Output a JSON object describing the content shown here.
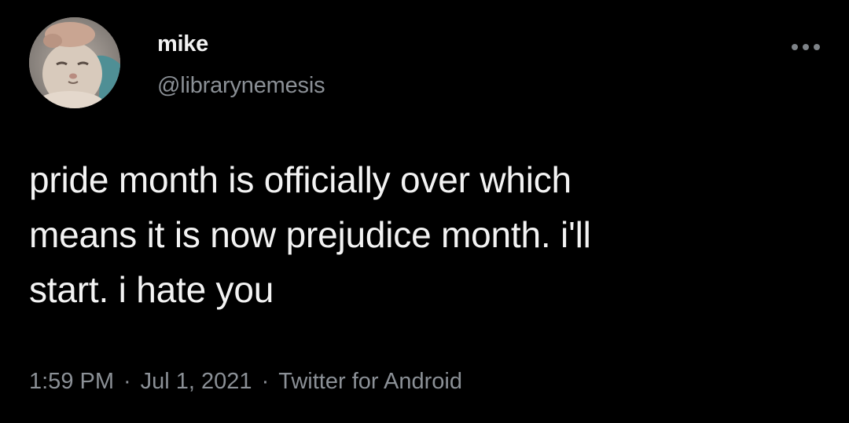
{
  "tweet": {
    "author": {
      "display_name": "mike",
      "handle": "@librarynemesis",
      "avatar_icon": "cat-avatar"
    },
    "more_icon": "ellipsis-icon",
    "text": "pride month is officially over which\nmeans it is now prejudice month. i'll\nstart. i hate you",
    "time": "1:59 PM",
    "separator": "·",
    "date": "Jul 1, 2021",
    "source": "Twitter for Android"
  },
  "colors": {
    "background": "#000000",
    "primary_text": "#f3f3f3",
    "secondary_text": "#8b9096"
  }
}
